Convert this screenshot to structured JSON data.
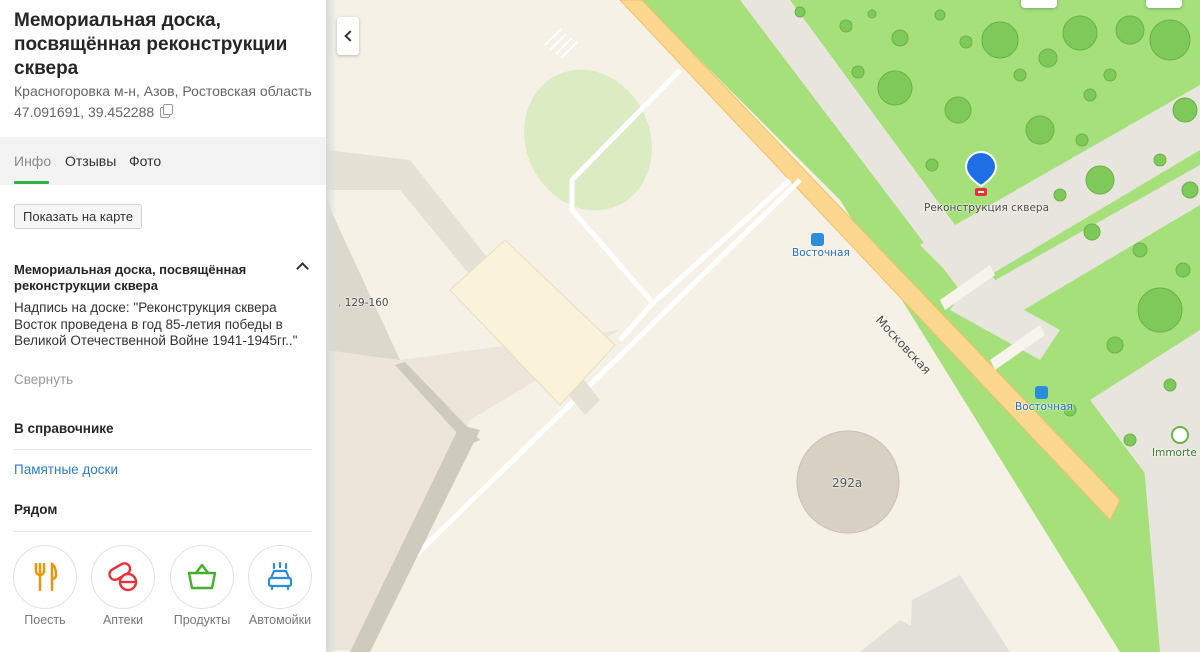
{
  "place": {
    "title": "Мемориальная доска, посвящённая реконструкции сквера",
    "address": "Красногоровка м-н, Азов, Ростовская область",
    "coordinates": "47.091691, 39.452288"
  },
  "tabs": [
    {
      "label": "Инфо",
      "active": true
    },
    {
      "label": "Отзывы",
      "active": false
    },
    {
      "label": "Фото",
      "active": false
    }
  ],
  "show_on_map_button": "Показать на карте",
  "description": {
    "title": "Мемориальная доска, посвящённая реконструкции сквера",
    "text": "Надпись на доске: \"Реконструкция сквера Восток проведена в год 85-летия победы в Великой Отечественной Войне 1941-1945гг..\"",
    "collapse_label": "Свернуть"
  },
  "directory": {
    "title": "В справочнике",
    "link": "Памятные доски"
  },
  "nearby": {
    "title": "Рядом",
    "items": [
      {
        "label": "Поесть",
        "icon": "fork-knife-icon",
        "color": "#f39200"
      },
      {
        "label": "Аптеки",
        "icon": "pills-icon",
        "color": "#e8313a"
      },
      {
        "label": "Продукты",
        "icon": "basket-icon",
        "color": "#43b02a"
      },
      {
        "label": "Автомойки",
        "icon": "car-wash-icon",
        "color": "#2b8ddb"
      }
    ]
  },
  "map": {
    "selected_marker_label": "Реконструкция сквера",
    "street_label": "Московская",
    "bus_stops": [
      "Восточная",
      "Восточная"
    ],
    "house_numbers": [
      "129-160",
      "292а"
    ],
    "poi_label": "Immorte",
    "colors": {
      "marker": "#1e6fe6",
      "park": "#a5e07a",
      "road": "#fbd78f",
      "ground": "#f5f1e6",
      "accent": "#2fb344"
    }
  }
}
